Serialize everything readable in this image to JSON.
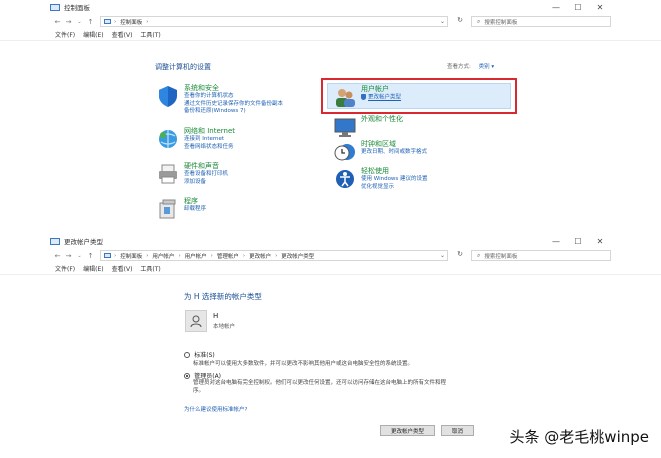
{
  "window1": {
    "title": "控制面板",
    "address": [
      "控制面板"
    ],
    "search_placeholder": "搜索控制面板",
    "menu": [
      "文件(F)",
      "编辑(E)",
      "查看(V)",
      "工具(T)"
    ],
    "heading": "调整计算机的设置",
    "view_by_label": "查看方式:",
    "view_by_value": "类别 ▾",
    "categories": [
      {
        "title": "系统和安全",
        "links": [
          "查看你的计算机状态",
          "通过文件历史记录保存你的文件备份副本",
          "备份和还原(Windows 7)"
        ]
      },
      {
        "title": "网络和 Internet",
        "links": [
          "连接到 Internet",
          "查看网络状态和任务"
        ]
      },
      {
        "title": "硬件和声音",
        "links": [
          "查看设备和打印机",
          "添加设备"
        ]
      },
      {
        "title": "程序",
        "links": [
          "卸载程序"
        ]
      },
      {
        "title": "用户帐户",
        "links": [
          "更改帐户类型"
        ]
      },
      {
        "title": "外观和个性化",
        "links": []
      },
      {
        "title": "时钟和区域",
        "links": [
          "更改日期、时间或数字格式"
        ]
      },
      {
        "title": "轻松使用",
        "links": [
          "使用 Windows 建议的设置",
          "优化视觉显示"
        ]
      }
    ]
  },
  "window2": {
    "title": "更改帐户类型",
    "address": [
      "控制面板",
      "用户帐户",
      "用户帐户",
      "管理帐户",
      "更改帐户",
      "更改帐户类型"
    ],
    "search_placeholder": "搜索控制面板",
    "menu": [
      "文件(F)",
      "编辑(E)",
      "查看(V)",
      "工具(T)"
    ],
    "heading": "为 H 选择新的帐户类型",
    "user_name": "H",
    "user_type": "本地帐户",
    "standard_label": "标准(S)",
    "standard_desc": "标准帐户可以使用大多数软件，并可以更改不影响其他用户或这台电脑安全性的系统设置。",
    "admin_label": "管理员(A)",
    "admin_desc_1": "管理员对这台电脑有完全控制权。他们可以更改任何设置，还可以访问存储在这台电脑上的所有文件和程",
    "admin_desc_2": "序。",
    "help_link": "为什么建议使用标准帐户?",
    "change_button": "更改帐户类型",
    "cancel_button": "取消"
  },
  "watermark": "头条 @老毛桃winpe"
}
